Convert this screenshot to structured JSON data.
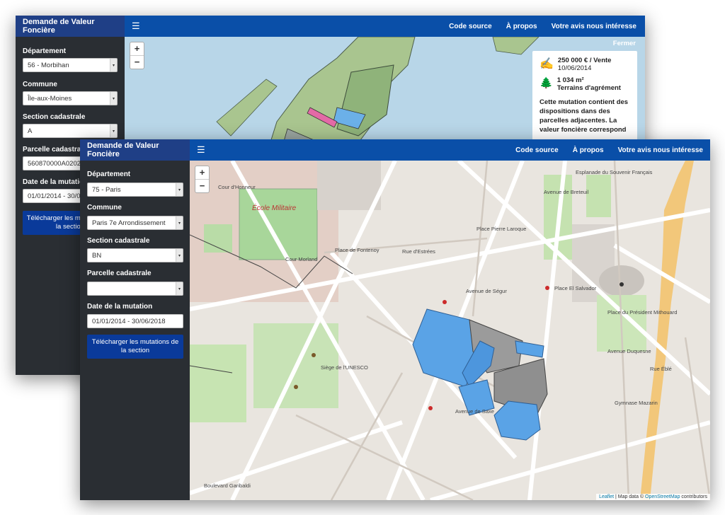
{
  "app_title": "Demande de Valeur Foncière",
  "nav": {
    "source": "Code source",
    "about": "À propos",
    "feedback": "Votre avis nous intéresse"
  },
  "back_window": {
    "departement_label": "Département",
    "departement_value": "56 - Morbihan",
    "commune_label": "Commune",
    "commune_value": "Île-aux-Moines",
    "section_label": "Section cadastrale",
    "section_value": "A",
    "parcelle_label": "Parcelle cadastrale",
    "parcelle_value": "560870000A0202",
    "date_label": "Date de la mutation",
    "date_value": "01/01/2014 - 30/06/2018",
    "download_label": "Télécharger les mutations de la section",
    "popup": {
      "close": "Fermer",
      "price": "250 000 € / Vente",
      "date": "10/06/2014",
      "area": "1 034 m²",
      "type": "Terrains d'agrément",
      "note": "Cette mutation contient des dispositions dans des parcelles adjacentes. La valeur foncière correspond"
    }
  },
  "front_window": {
    "departement_label": "Département",
    "departement_value": "75 - Paris",
    "commune_label": "Commune",
    "commune_value": "Paris 7e Arrondissement",
    "section_label": "Section cadastrale",
    "section_value": "BN",
    "parcelle_label": "Parcelle cadastrale",
    "parcelle_value": "",
    "date_label": "Date de la mutation",
    "date_value": "01/01/2014 - 30/06/2018",
    "download_label": "Télécharger les mutations de la section",
    "attribution": {
      "leaflet": "Leaflet",
      "map_data": " | Map data © ",
      "osm": "OpenStreetMap",
      "contrib": " contributors"
    },
    "map_labels": [
      "École Militaire",
      "Cour d'Honneur",
      "Cour Morland",
      "Place de Fontenoy",
      "Place Pierre Laroque",
      "Place El Salvador",
      "Place du Président Mithouard",
      "Avenue de Saxe",
      "Avenue de Ségur",
      "Rue d'Estrées",
      "Boulevard Garibaldi",
      "Avenue Duquesne",
      "Avenue de Breteuil",
      "Rue Éblé",
      "Siège de l'UNESCO",
      "Gymnase Mazarin",
      "Esplanade du Souvenir Français"
    ]
  },
  "icons": {
    "menu": "hamburger-icon",
    "price": "signature-icon",
    "area": "tree-icon",
    "zoom_in": "plus-icon",
    "zoom_out": "minus-icon"
  },
  "colors": {
    "navbar": "#0a4fa8",
    "sidebar": "#2a2e33",
    "brand": "#1f3f86",
    "parcel_highlight": "#3c8fe0",
    "button": "#0a3a9a"
  }
}
